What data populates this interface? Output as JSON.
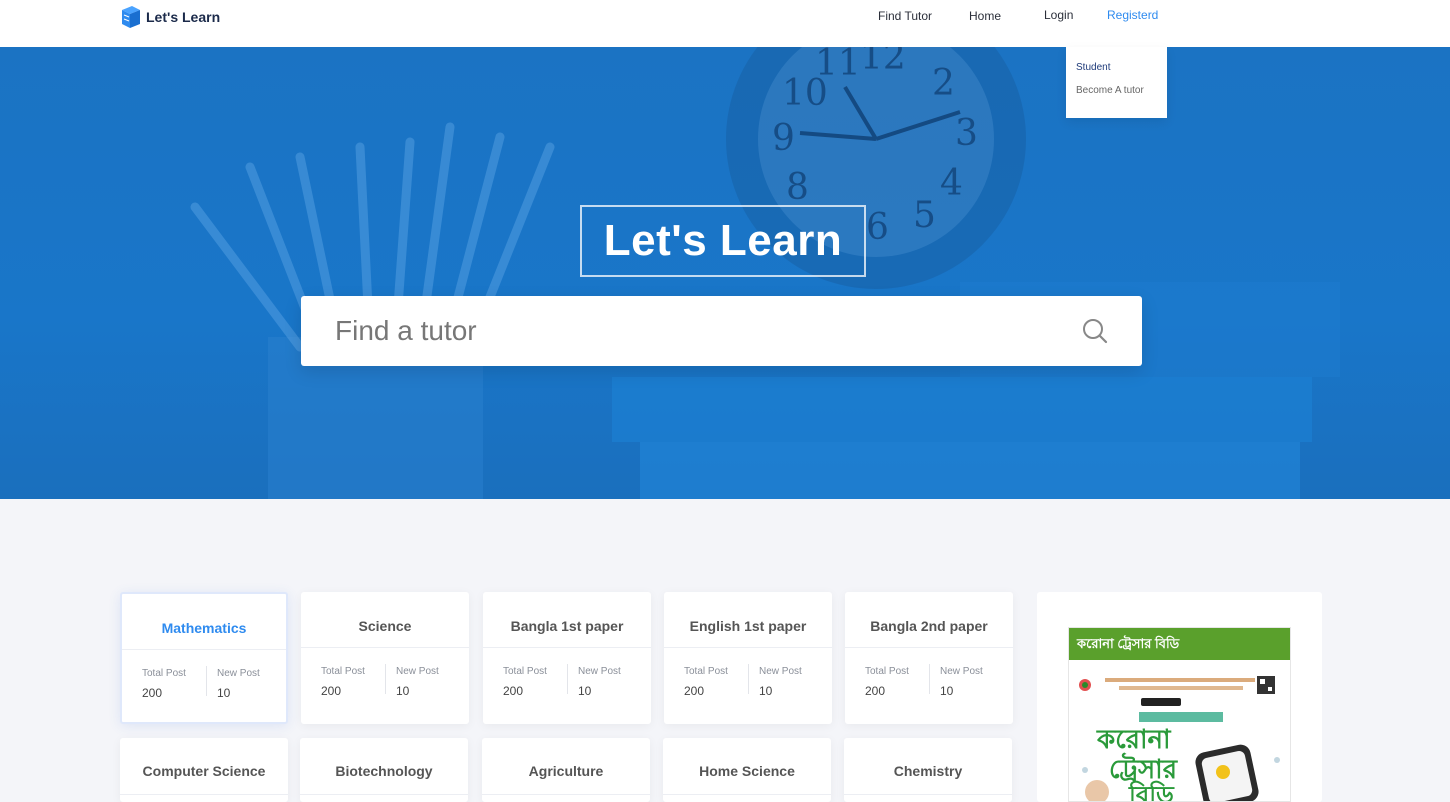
{
  "navbar": {
    "brand": "Let's Learn",
    "links": [
      "Find Tutor",
      "Home",
      "Login",
      "Registerd"
    ],
    "dropdown": [
      "Student",
      "Become A tutor"
    ]
  },
  "hero": {
    "title": "Let's Learn",
    "search_placeholder": "Find a tutor"
  },
  "subjects_row1": [
    {
      "name": "Mathematics",
      "total_label": "Total Post",
      "total": "200",
      "new_label": "New Post",
      "new": "10"
    },
    {
      "name": "Science",
      "total_label": "Total Post",
      "total": "200",
      "new_label": "New Post",
      "new": "10"
    },
    {
      "name": "Bangla 1st paper",
      "total_label": "Total Post",
      "total": "200",
      "new_label": "New Post",
      "new": "10"
    },
    {
      "name": "English 1st paper",
      "total_label": "Total Post",
      "total": "200",
      "new_label": "New Post",
      "new": "10"
    },
    {
      "name": "Bangla 2nd paper",
      "total_label": "Total Post",
      "total": "200",
      "new_label": "New Post",
      "new": "10"
    }
  ],
  "subjects_row2": [
    {
      "name": "Computer Science"
    },
    {
      "name": "Biotechnology"
    },
    {
      "name": "Agriculture"
    },
    {
      "name": "Home Science"
    },
    {
      "name": "Chemistry"
    }
  ],
  "ad": {
    "header": "করোনা ট্রেসার বিডি"
  }
}
